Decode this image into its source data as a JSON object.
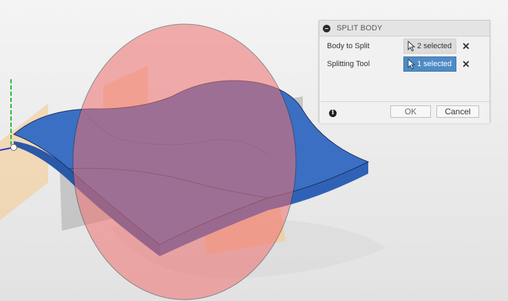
{
  "dialog": {
    "title": "SPLIT BODY",
    "rows": [
      {
        "label": "Body to Split",
        "selection": "2 selected",
        "state": "inactive"
      },
      {
        "label": "Splitting Tool",
        "selection": "1 selected",
        "state": "active"
      }
    ],
    "ok_label": "OK",
    "cancel_label": "Cancel",
    "clear_symbol": "✕",
    "info_symbol": "i"
  },
  "viewport": {
    "body_color": "#3a6fc4",
    "splitting_tool_color": "#f08080",
    "construction_plane_color": "#f5c88c"
  }
}
